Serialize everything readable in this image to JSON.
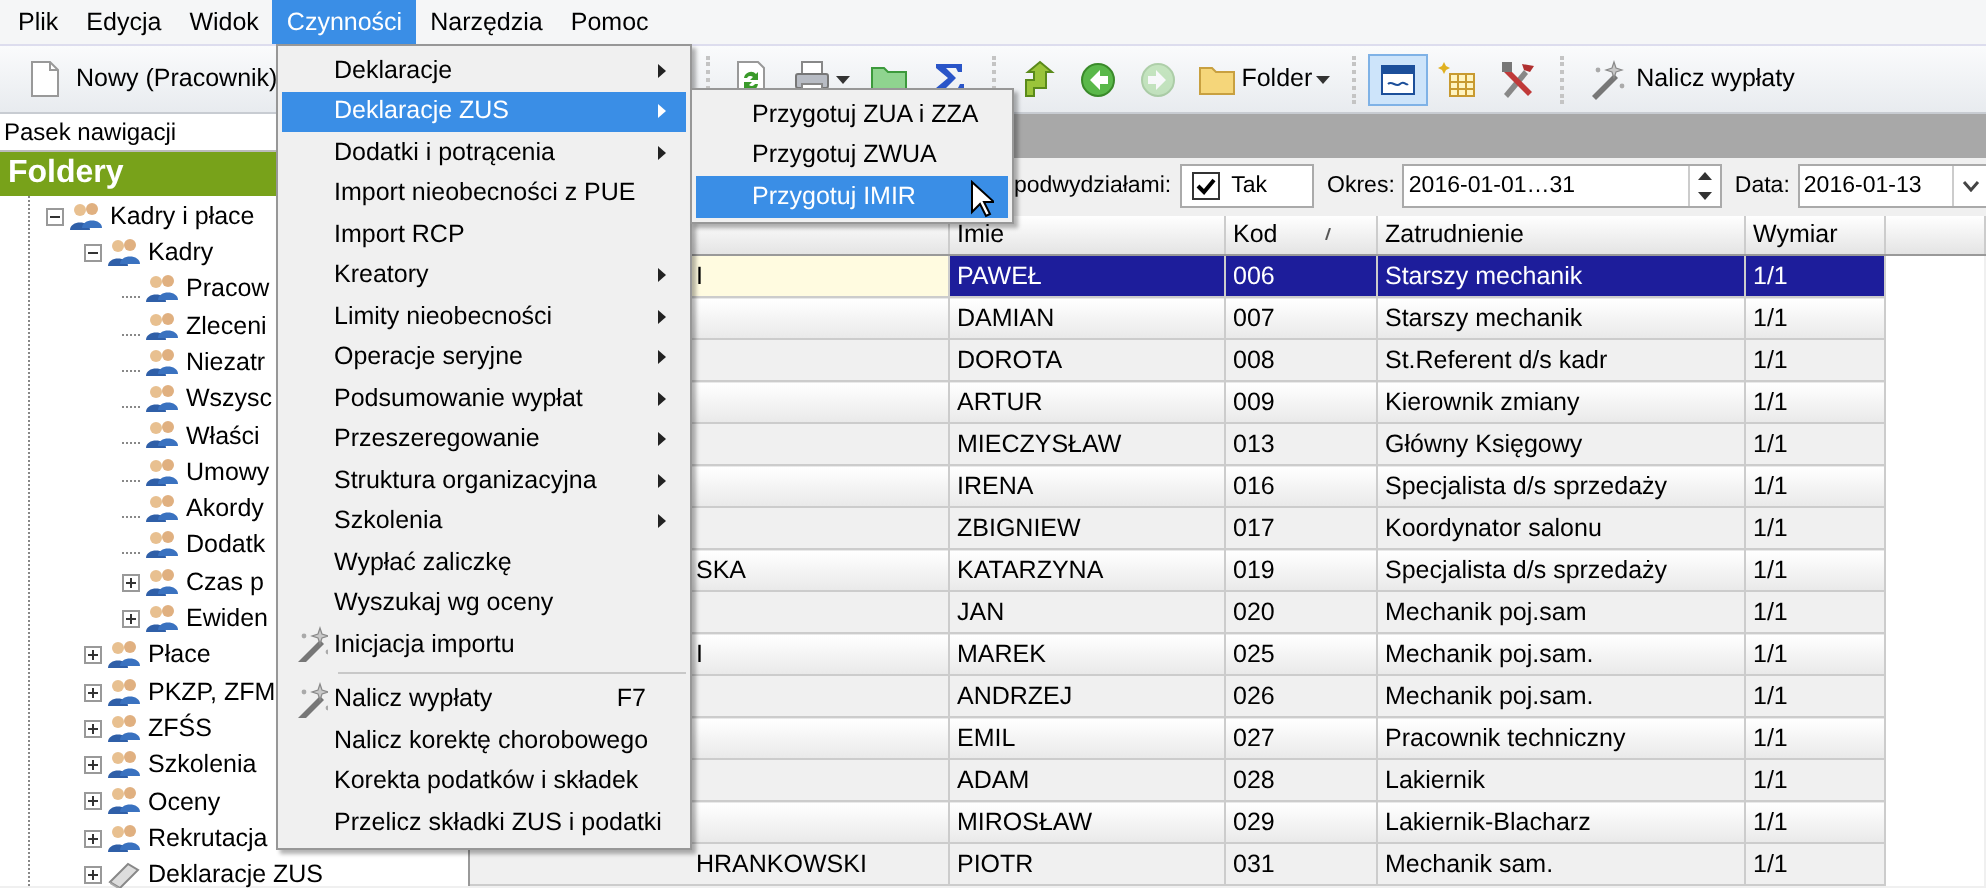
{
  "menu_bar": [
    {
      "label": "Plik",
      "selected": false
    },
    {
      "label": "Edycja",
      "selected": false
    },
    {
      "label": "Widok",
      "selected": false
    },
    {
      "label": "Czynności",
      "selected": true
    },
    {
      "label": "Narzędzia",
      "selected": false
    },
    {
      "label": "Pomoc",
      "selected": false
    }
  ],
  "toolbar": {
    "new_button": {
      "label": "Nowy (Pracownik)"
    },
    "items": [
      {
        "kind": "separator"
      },
      {
        "kind": "button",
        "disabled": false,
        "pressed": false
      },
      {
        "kind": "dropdown",
        "disabled": false,
        "pressed": false
      },
      {
        "kind": "button",
        "disabled": false,
        "pressed": false
      },
      {
        "kind": "button",
        "disabled": false,
        "pressed": false
      },
      {
        "kind": "separator"
      },
      {
        "kind": "button",
        "disabled": false,
        "pressed": false
      },
      {
        "kind": "button",
        "disabled": false,
        "pressed": false
      },
      {
        "kind": "button",
        "disabled": true,
        "pressed": false
      },
      {
        "kind": "dropdown",
        "label": "Folder",
        "disabled": false,
        "pressed": false
      },
      {
        "kind": "separator"
      },
      {
        "kind": "button",
        "disabled": false,
        "pressed": true
      },
      {
        "kind": "button",
        "disabled": false,
        "pressed": false
      },
      {
        "kind": "button",
        "disabled": false,
        "pressed": false
      },
      {
        "kind": "separator"
      },
      {
        "kind": "button",
        "label": "Nalicz wypłaty",
        "disabled": false,
        "pressed": false
      }
    ]
  },
  "navigation": {
    "title": "Pasek nawigacji",
    "header": "Foldery",
    "tree": [
      {
        "label": "Kadry i płace",
        "kind": "group",
        "expanded": true,
        "children": [
          {
            "label": "Kadry",
            "kind": "group",
            "expanded": true,
            "children": [
              {
                "label": "Pracow",
                "kind": "group"
              },
              {
                "label": "Zleceni",
                "kind": "group"
              },
              {
                "label": "Niezatr",
                "kind": "group"
              },
              {
                "label": "Wszysc",
                "kind": "group"
              },
              {
                "label": "Właści",
                "kind": "group"
              },
              {
                "label": "Umowy",
                "kind": "group"
              },
              {
                "label": "Akordy",
                "kind": "group"
              },
              {
                "label": "Dodatk",
                "kind": "group"
              },
              {
                "label": "Czas p",
                "kind": "group",
                "expanded": false
              },
              {
                "label": "Ewiden",
                "kind": "group",
                "expanded": false
              }
            ]
          },
          {
            "label": "Płace",
            "kind": "group",
            "expanded": false
          },
          {
            "label": "PKZP, ZFM",
            "kind": "group",
            "expanded": false
          },
          {
            "label": "ZFŚS",
            "kind": "group",
            "expanded": false
          },
          {
            "label": "Szkolenia",
            "kind": "group",
            "expanded": false
          },
          {
            "label": "Oceny",
            "kind": "group",
            "expanded": false
          },
          {
            "label": "Rekrutacja",
            "kind": "group",
            "expanded": false
          },
          {
            "label": "Deklaracje ZUS",
            "kind": "declaration",
            "expanded": false
          }
        ]
      }
    ]
  },
  "filters": {
    "subdivisions": {
      "label": "podwydziałami:",
      "checked": true,
      "value": "Tak"
    },
    "period": {
      "label": "Okres:",
      "value": "2016-01-01…31"
    },
    "date": {
      "label": "Data:",
      "value": "2016-01-13"
    }
  },
  "table": {
    "columns": [
      {
        "label": "Imie",
        "sorted": false
      },
      {
        "label": "Kod",
        "sorted": true
      },
      {
        "label": "Zatrudnienie",
        "sorted": false
      },
      {
        "label": "Wymiar",
        "sorted": false
      }
    ],
    "rows": [
      {
        "column_1": "I",
        "cells": [
          "PAWEŁ",
          "006",
          "Starszy mechanik",
          "1/1"
        ],
        "selected": true
      },
      {
        "cells": [
          "DAMIAN",
          "007",
          "Starszy mechanik",
          "1/1"
        ],
        "selected": false
      },
      {
        "cells": [
          "DOROTA",
          "008",
          "St.Referent d/s kadr",
          "1/1"
        ],
        "selected": false
      },
      {
        "cells": [
          "ARTUR",
          "009",
          "Kierownik zmiany",
          "1/1"
        ],
        "selected": false
      },
      {
        "cells": [
          "MIECZYSŁAW",
          "013",
          "Główny Księgowy",
          "1/1"
        ],
        "selected": false
      },
      {
        "cells": [
          "IRENA",
          "016",
          "Specjalista d/s sprzedaży",
          "1/1"
        ],
        "selected": false
      },
      {
        "cells": [
          "ZBIGNIEW",
          "017",
          "Koordynator salonu",
          "1/1"
        ],
        "selected": false
      },
      {
        "column_1": "SKA",
        "cells": [
          "KATARZYNA",
          "019",
          "Specjalista d/s sprzedaży",
          "1/1"
        ],
        "selected": false
      },
      {
        "cells": [
          "JAN",
          "020",
          "Mechanik poj.sam",
          "1/1"
        ],
        "selected": false
      },
      {
        "column_1": "I",
        "cells": [
          "MAREK",
          "025",
          "Mechanik poj.sam.",
          "1/1"
        ],
        "selected": false
      },
      {
        "cells": [
          "ANDRZEJ",
          "026",
          "Mechanik poj.sam.",
          "1/1"
        ],
        "selected": false
      },
      {
        "cells": [
          "EMIL",
          "027",
          "Pracownik techniczny",
          "1/1"
        ],
        "selected": false
      },
      {
        "cells": [
          "ADAM",
          "028",
          "Lakiernik",
          "1/1"
        ],
        "selected": false
      },
      {
        "cells": [
          "MIROSŁAW",
          "029",
          "Lakiernik-Blacharz",
          "1/1"
        ],
        "selected": false
      },
      {
        "column_1": "HRANKOWSKI",
        "cells": [
          "PIOTR",
          "031",
          "Mechanik sam.",
          "1/1"
        ],
        "selected": false
      }
    ]
  },
  "menu": {
    "items": [
      {
        "kind": "item",
        "label": "Deklaracje",
        "submenu": true,
        "selected": false
      },
      {
        "kind": "item",
        "label": "Deklaracje ZUS",
        "submenu": true,
        "selected": true
      },
      {
        "kind": "item",
        "label": "Dodatki i potrącenia",
        "submenu": true,
        "selected": false
      },
      {
        "kind": "item",
        "label": "Import nieobecności z PUE",
        "submenu": false,
        "selected": false
      },
      {
        "kind": "item",
        "label": "Import RCP",
        "submenu": false,
        "selected": false
      },
      {
        "kind": "item",
        "label": "Kreatory",
        "submenu": true,
        "selected": false
      },
      {
        "kind": "item",
        "label": "Limity nieobecności",
        "submenu": true,
        "selected": false
      },
      {
        "kind": "item",
        "label": "Operacje seryjne",
        "submenu": true,
        "selected": false
      },
      {
        "kind": "item",
        "label": "Podsumowanie wypłat",
        "submenu": true,
        "selected": false
      },
      {
        "kind": "item",
        "label": "Przeszeregowanie",
        "submenu": true,
        "selected": false
      },
      {
        "kind": "item",
        "label": "Struktura organizacyjna",
        "submenu": true,
        "selected": false
      },
      {
        "kind": "item",
        "label": "Szkolenia",
        "submenu": true,
        "selected": false
      },
      {
        "kind": "item",
        "label": "Wypłać zaliczkę",
        "submenu": false,
        "selected": false
      },
      {
        "kind": "item",
        "label": "Wyszukaj wg oceny",
        "submenu": false,
        "selected": false
      },
      {
        "kind": "item",
        "label": "Inicjacja importu",
        "submenu": false,
        "selected": false,
        "icon": true
      },
      {
        "kind": "separator"
      },
      {
        "kind": "item",
        "label": "Nalicz wypłaty",
        "shortcut": "F7",
        "submenu": false,
        "selected": false,
        "icon": true
      },
      {
        "kind": "item",
        "label": "Nalicz korektę chorobowego",
        "submenu": false,
        "selected": false
      },
      {
        "kind": "item",
        "label": "Korekta podatków i składek",
        "submenu": false,
        "selected": false
      },
      {
        "kind": "item",
        "label": "Przelicz składki ZUS i podatki",
        "submenu": false,
        "selected": false
      }
    ]
  },
  "submenu": {
    "items": [
      {
        "label": "Przygotuj ZUA i ZZA",
        "selected": false
      },
      {
        "label": "Przygotuj ZWUA",
        "selected": false
      },
      {
        "label": "Przygotuj IMIR",
        "selected": true
      }
    ]
  }
}
